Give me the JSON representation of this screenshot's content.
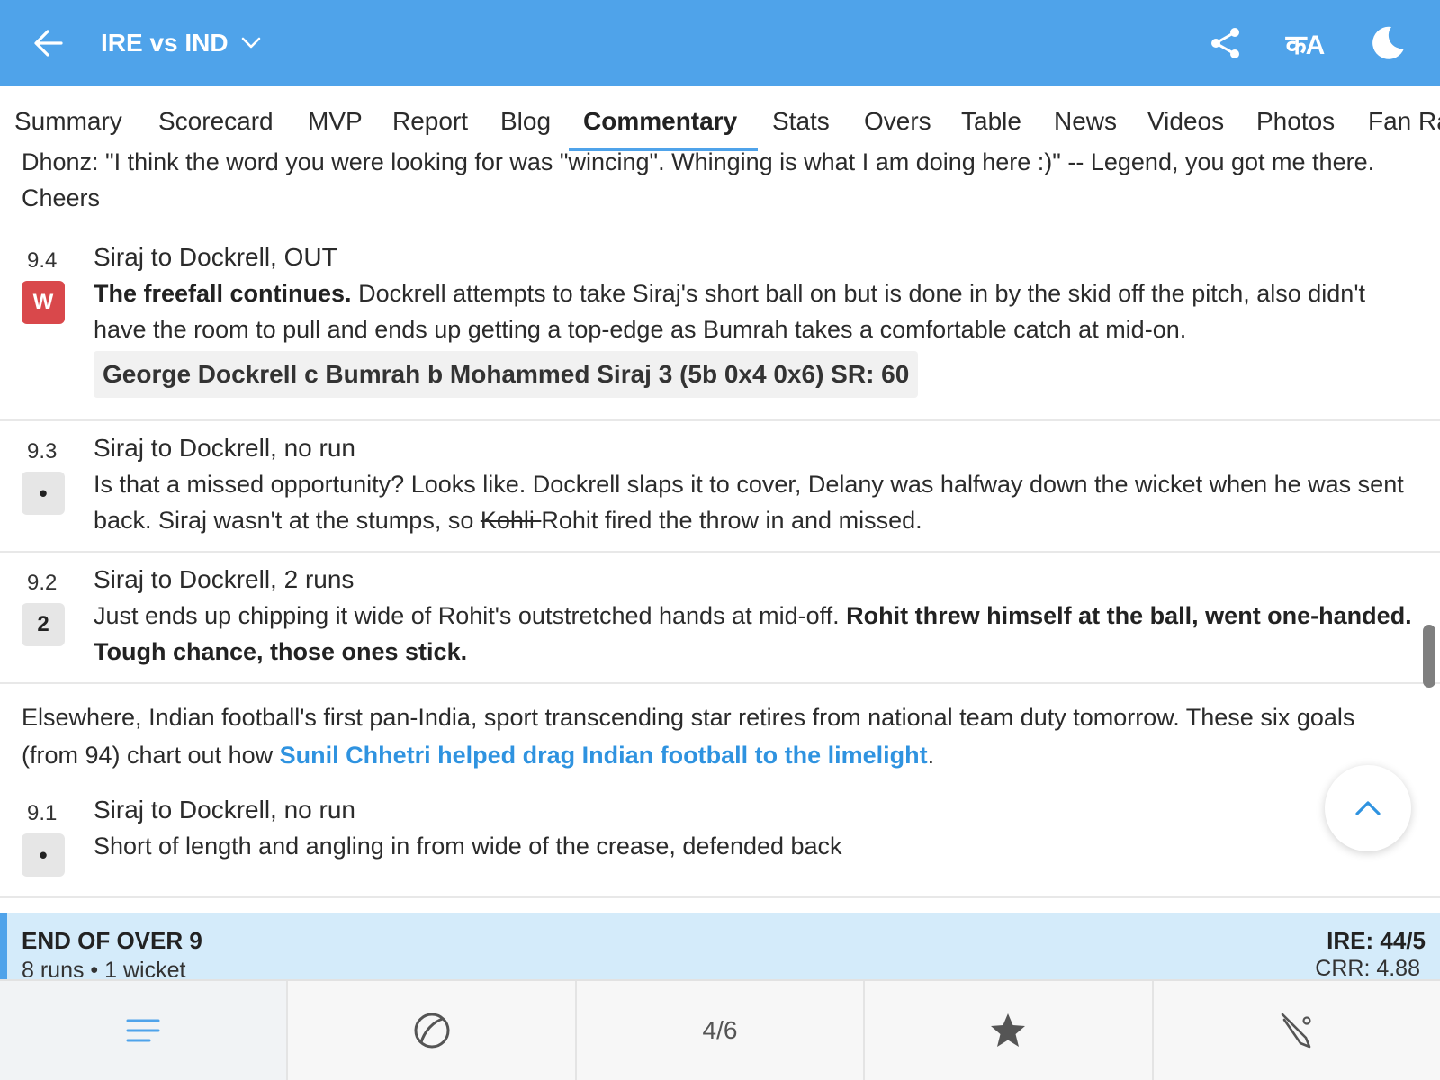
{
  "header": {
    "title": "IRE vs IND",
    "lang_icon_text": "कA",
    "bg_color": "#4fa3ea"
  },
  "tabs": [
    {
      "label": "Summary"
    },
    {
      "label": "Scorecard"
    },
    {
      "label": "MVP"
    },
    {
      "label": "Report"
    },
    {
      "label": "Blog"
    },
    {
      "label": "Commentary",
      "active": true
    },
    {
      "label": "Stats"
    },
    {
      "label": "Overs"
    },
    {
      "label": "Table"
    },
    {
      "label": "News"
    },
    {
      "label": "Videos"
    },
    {
      "label": "Photos"
    },
    {
      "label": "Fan Ra"
    }
  ],
  "commentary": {
    "partial_note": "Dhonz: \"I think the word you were looking for was \"wincing\". Whinging is what I am doing here :)\" -- Legend, you got me there. Cheers",
    "balls": [
      {
        "over": "9.4",
        "badge": "W",
        "headline": "Siraj to Dockrell, OUT",
        "bold_text": "The freefall continues.",
        "text": " Dockrell attempts to take Siraj's short ball on but is done in by the skid off the pitch, also didn't have the room to pull and ends up getting a top-edge as Bumrah takes a comfortable catch at mid-on.",
        "dismissal": "George Dockrell c Bumrah b Mohammed Siraj 3 (5b 0x4 0x6) SR: 60"
      },
      {
        "over": "9.3",
        "badge": "•",
        "headline": "Siraj to Dockrell, no run",
        "text": "Is that a missed opportunity? Looks like. Dockrell slaps it to cover, Delany was halfway down the wicket when he was sent back. Siraj wasn't at the stumps, so ",
        "strike": "Kohli ",
        "text_after": "Rohit fired the throw in and missed."
      },
      {
        "over": "9.2",
        "badge": "2",
        "headline": "Siraj to Dockrell, 2 runs",
        "text": "Just ends up chipping it wide of Rohit's outstretched hands at mid-off. ",
        "bold_text": "Rohit threw himself at the ball, went one-handed. Tough chance, those ones stick."
      },
      {
        "over": "9.1",
        "badge": "•",
        "headline": "Siraj to Dockrell, no run",
        "text": "Short of length and angling in from wide of the crease, defended back"
      }
    ],
    "note": {
      "text": "Elsewhere, Indian football's first pan-India, sport transcending star retires from national team duty tomorrow. These six goals (from 94) chart out how ",
      "link": "Sunil Chhetri helped drag Indian football to the limelight",
      "end": "."
    },
    "end_of_over": {
      "title": "END OF OVER 9",
      "summary": "8 runs • 1 wicket",
      "score": "IRE: 44/5",
      "crr": "CRR: 4.88"
    }
  },
  "bottom_nav": {
    "page": "4/6",
    "items": [
      "menu-icon",
      "ball-icon",
      "page-counter",
      "star-icon",
      "bat-icon"
    ]
  },
  "colors": {
    "accent": "#4fa3ea",
    "wicket": "#d9484b",
    "link": "#2f93e0",
    "end_over_bg": "#d4ebfa"
  }
}
